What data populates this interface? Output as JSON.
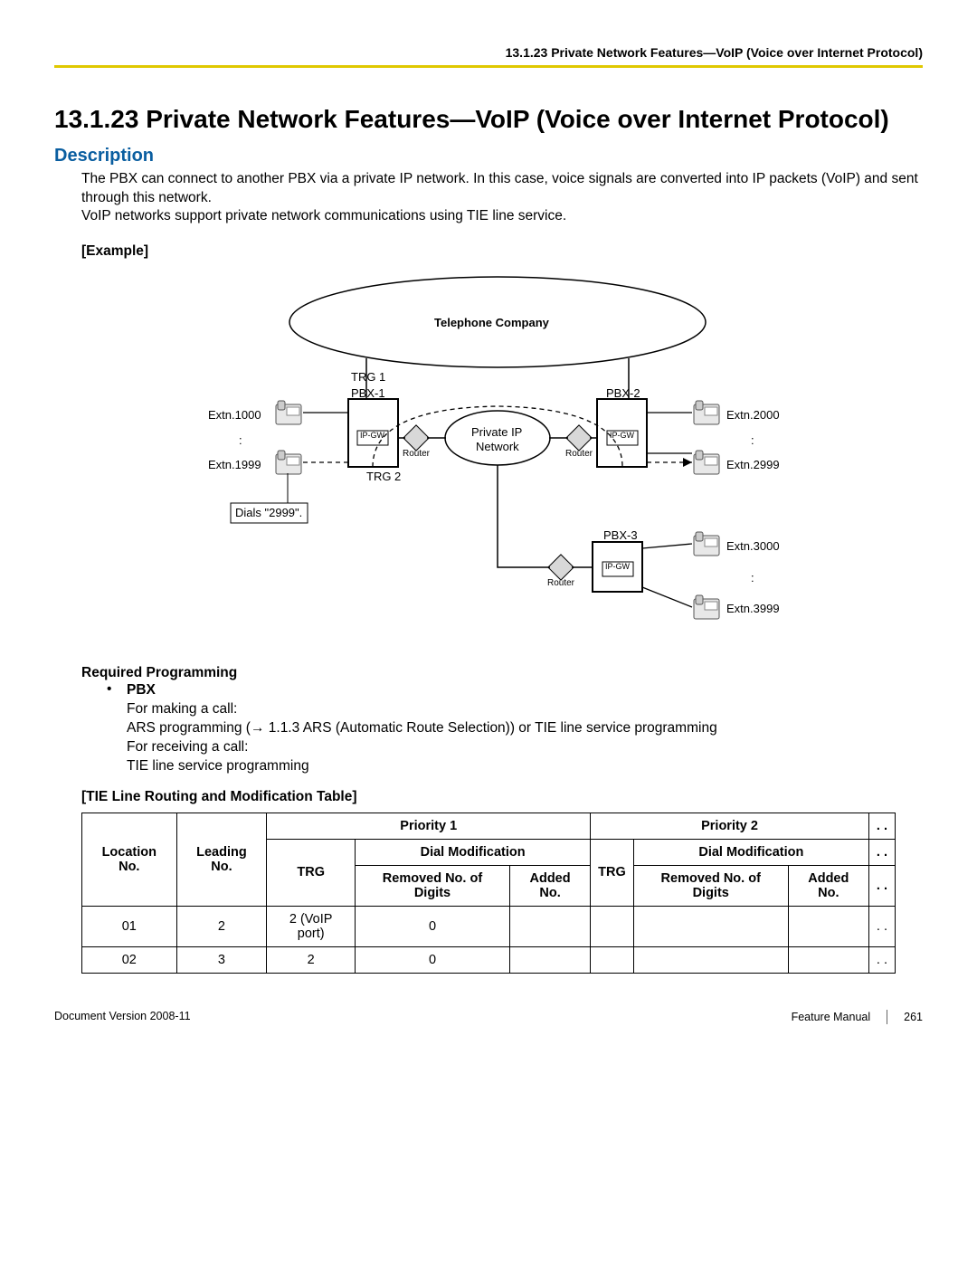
{
  "header": {
    "running_title": "13.1.23 Private Network Features—VoIP (Voice over Internet Protocol)"
  },
  "title": "13.1.23  Private Network Features—VoIP (Voice over Internet Protocol)",
  "description_heading": "Description",
  "description_p1": "The PBX can connect to another PBX via a private IP network. In this case, voice signals are converted into IP packets (VoIP) and sent through this network.",
  "description_p2": "VoIP networks support private network communications using TIE line service.",
  "example_label": "[Example]",
  "diagram": {
    "telco": "Telephone Company",
    "trg1": "TRG 1",
    "trg2": "TRG 2",
    "pbx1": "PBX-1",
    "pbx2": "PBX-2",
    "pbx3": "PBX-3",
    "ipgw": "IP-GW",
    "router": "Router",
    "private_ip": "Private IP",
    "network": "Network",
    "extn1000": "Extn.1000",
    "extn1999": "Extn.1999",
    "extn2000": "Extn.2000",
    "extn2999": "Extn.2999",
    "extn3000": "Extn.3000",
    "extn3999": "Extn.3999",
    "dials": "Dials \"2999\".",
    "colon": ":"
  },
  "required_programming_label": "Required Programming",
  "pbx_bullet": {
    "title": "PBX",
    "l1": "For making a call:",
    "l2": "ARS programming (→ 1.1.3  ARS (Automatic Route Selection)) or TIE line service programming",
    "l3": "For receiving a call:",
    "l4": "TIE line service programming"
  },
  "tie_table_label": "[TIE Line Routing and Modification Table]",
  "tie_table": {
    "priority1": "Priority 1",
    "priority2": "Priority 2",
    "dots": ". .",
    "dial_mod": "Dial Modification",
    "location_no": "Location No.",
    "leading_no": "Leading No.",
    "trg": "TRG",
    "removed": "Removed No. of Digits",
    "added": "Added No.",
    "rows": [
      {
        "loc": "01",
        "lead": "2",
        "trg": "2 (VoIP port)",
        "rem": "0",
        "add": "",
        "trg2": "",
        "rem2": "",
        "add2": "",
        "dots": ". ."
      },
      {
        "loc": "02",
        "lead": "3",
        "trg": "2",
        "rem": "0",
        "add": "",
        "trg2": "",
        "rem2": "",
        "add2": "",
        "dots": ". ."
      }
    ]
  },
  "footer": {
    "doc_version": "Document Version  2008-11",
    "manual_name": "Feature Manual",
    "page_no": "261"
  }
}
